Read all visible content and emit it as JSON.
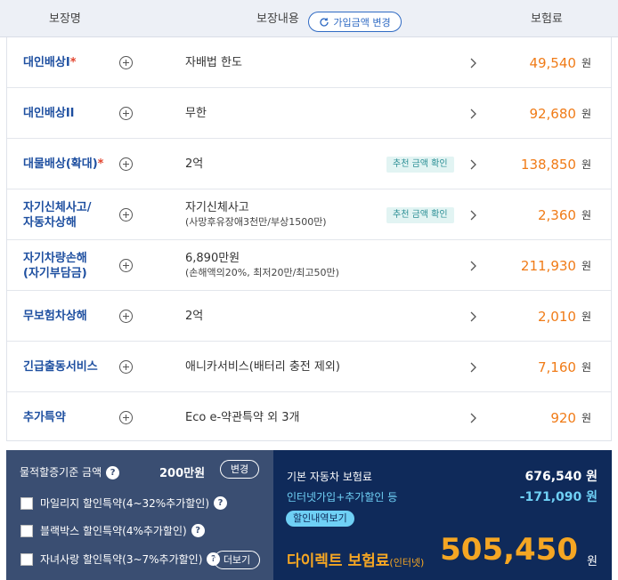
{
  "header": {
    "col_name": "보장명",
    "col_content": "보장내용",
    "change_button": "가입금액 변경",
    "col_premium": "보험료"
  },
  "rows": [
    {
      "name_lines": [
        "대인배상I"
      ],
      "required": true,
      "content": "자배법 한도",
      "sub": "",
      "badge": "",
      "premium": "49,540",
      "unit": "원"
    },
    {
      "name_lines": [
        "대인배상II"
      ],
      "required": false,
      "content": "무한",
      "sub": "",
      "badge": "",
      "premium": "92,680",
      "unit": "원"
    },
    {
      "name_lines": [
        "대물배상(확대)"
      ],
      "required": true,
      "content": "2억",
      "sub": "",
      "badge": "추천 금액 확인",
      "premium": "138,850",
      "unit": "원"
    },
    {
      "name_lines": [
        "자기신체사고/",
        "자동차상해"
      ],
      "required": false,
      "content": "자기신체사고",
      "sub": "(사망후유장애3천만/부상1500만)",
      "badge": "추천 금액 확인",
      "premium": "2,360",
      "unit": "원"
    },
    {
      "name_lines": [
        "자기차량손해",
        "(자기부담금)"
      ],
      "required": false,
      "content": "6,890만원",
      "sub": "(손해액의20%, 최저20만/최고50만)",
      "badge": "",
      "premium": "211,930",
      "unit": "원"
    },
    {
      "name_lines": [
        "무보험차상해"
      ],
      "required": false,
      "content": "2억",
      "sub": "",
      "badge": "",
      "premium": "2,010",
      "unit": "원"
    },
    {
      "name_lines": [
        "긴급출동서비스"
      ],
      "required": false,
      "content": "애니카서비스(배터리 충전 제외)",
      "sub": "",
      "badge": "",
      "premium": "7,160",
      "unit": "원"
    },
    {
      "name_lines": [
        "추가특약"
      ],
      "required": false,
      "content": "Eco e-약관특약 외 3개",
      "sub": "",
      "badge": "",
      "premium": "920",
      "unit": "원"
    }
  ],
  "options": {
    "threshold_label": "물적할증기준 금액",
    "threshold_value": "200만원",
    "change_label": "변경",
    "checkboxes": [
      "마일리지 할인특약(4~32%추가할인)",
      "블랙박스 할인특약(4%추가할인)",
      "자녀사랑 할인특약(3~7%추가할인)"
    ],
    "more_label": "더보기"
  },
  "summary": {
    "base_label": "기본 자동차 보험료",
    "base_value": "676,540 원",
    "discount_label": "인터넷가입+추가할인 등",
    "discount_value": "-171,090 원",
    "discount_button": "할인내역보기",
    "final_label": "다이렉트 보험료",
    "final_label_suffix": "(인터넷)",
    "final_amount": "505,450",
    "final_unit": "원"
  },
  "colors": {
    "accent_blue": "#1e4fa0",
    "price_orange": "#f07b17",
    "final_orange": "#f5a623",
    "discount_cyan": "#6fd0f5"
  }
}
